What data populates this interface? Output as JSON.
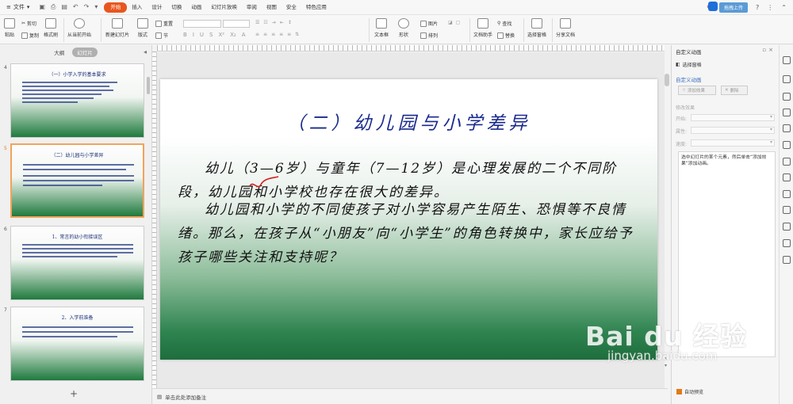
{
  "menubar": {
    "file_label": "文件",
    "tabs": [
      "开始",
      "插入",
      "设计",
      "切换",
      "动画",
      "幻灯片放映",
      "审阅",
      "视图",
      "安全",
      "特色应用"
    ],
    "active_tab": "开始",
    "upload_label": "拖拽上传"
  },
  "ribbon": {
    "paste": "粘贴",
    "cut": "剪切",
    "copy": "复制",
    "format_painter": "格式刷",
    "from_current": "从当前开始",
    "new_slide": "新建幻灯片",
    "layout": "版式",
    "reset": "重置",
    "section": "节",
    "textbox": "文本框",
    "shape": "形状",
    "picture": "图片",
    "arrange": "排列",
    "find": "查找",
    "replace": "替换",
    "doc_assistant": "文档助手",
    "select_pane": "选择窗格",
    "share_doc": "分享文档"
  },
  "leftpanel": {
    "tab_outline": "大纲",
    "tab_slides": "幻灯片",
    "add_label": "+"
  },
  "thumbnails": [
    {
      "num": "4",
      "title": "（一）小学入学的基本要求"
    },
    {
      "num": "5",
      "title": "（二）幼儿园与小学差异"
    },
    {
      "num": "6",
      "title": "1、常言的幼小衔接误区"
    },
    {
      "num": "7",
      "title": "2、入学前准备"
    }
  ],
  "slide": {
    "title": "（二）幼儿园与小学差异",
    "p1": "幼儿（3—6岁）与童年（7—12岁）是心理发展的二个不同阶段，幼儿园和小学校也存在很大的差异。",
    "p2": "幼儿园和小学的不同使孩子对小学容易产生陌生、恐惧等不良情绪。那么，在孩子从“小朋友”向“小学生”的角色转换中，家长应给予孩子哪些关注和支持呢？"
  },
  "notes_placeholder": "单击此处添加备注",
  "rpanel": {
    "title": "自定义动画",
    "select_pane": "选择窗格",
    "section_title": "自定义动画",
    "add_effect": "添加效果",
    "delete": "删除",
    "modify_effect": "修改效果",
    "start_label": "开始:",
    "property_label": "属性:",
    "speed_label": "速度:",
    "hint": "选中幻灯片的某个元素，然后单击“添加效果”添加动画。",
    "auto_preview": "自动预览"
  },
  "watermark": {
    "logo": "Bai du 经验",
    "url": "jingyan.baidu.com"
  },
  "colors": {
    "accent": "#e8561f",
    "slide_title": "#1a2a8c",
    "slide_green": "#1d6e3c"
  }
}
